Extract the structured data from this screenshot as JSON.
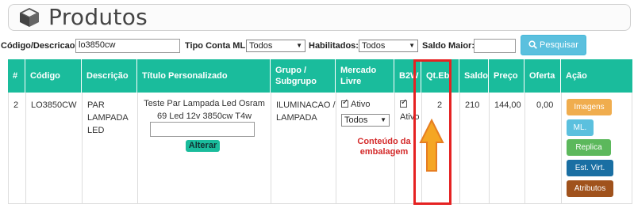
{
  "page": {
    "title": "Produtos"
  },
  "filters": {
    "codigo_label": "Código/Descricao:",
    "codigo_value": "lo3850cw",
    "tipo_conta_label": "Tipo Conta ML:",
    "tipo_conta_value": "Todos",
    "habilitados_label": "Habilitados:",
    "habilitados_value": "Todos",
    "saldo_label": "Saldo Maior:",
    "saldo_value": "",
    "search_button": "Pesquisar"
  },
  "table": {
    "headers": {
      "num": "#",
      "codigo": "Código",
      "descricao": "Descrição",
      "titulo": "Título Personalizado",
      "grupo": "Grupo / Subgrupo",
      "mercado": "Mercado Livre",
      "b2w": "B2W",
      "qteb": "Qt.Eb",
      "saldo": "Saldo",
      "preco": "Preço",
      "oferta": "Oferta",
      "acao": "Ação"
    },
    "row": {
      "num": "2",
      "codigo": "LO3850CW",
      "descricao": "PAR LAMPADA LED",
      "titulo": "Teste Par Lampada Led Osram 69 Led 12v 3850cw T4w",
      "alterar_button": "Alterar",
      "grupo": "ILUMINACAO / LAMPADA",
      "mercado_ativo_label": "Ativo",
      "mercado_select": "Todos",
      "b2w_ativo_label": "Ativo",
      "qteb": "2",
      "saldo": "210",
      "preco": "144,00",
      "oferta": "0,00"
    },
    "actions": [
      {
        "label": "Imagens",
        "color": "#f0ad4e"
      },
      {
        "label": "ML.",
        "color": "#5bc0de"
      },
      {
        "label": "Replica",
        "color": "#5cb85c"
      },
      {
        "label": "Est. Virt.",
        "color": "#1a6fa3"
      },
      {
        "label": "Atributos",
        "color": "#a0521c"
      }
    ]
  },
  "annotation": {
    "text": "Conteúdo da embalagem"
  },
  "colors": {
    "header_bg": "#1abc9c",
    "highlight": "#e52222",
    "arrow": "#f5a623"
  }
}
